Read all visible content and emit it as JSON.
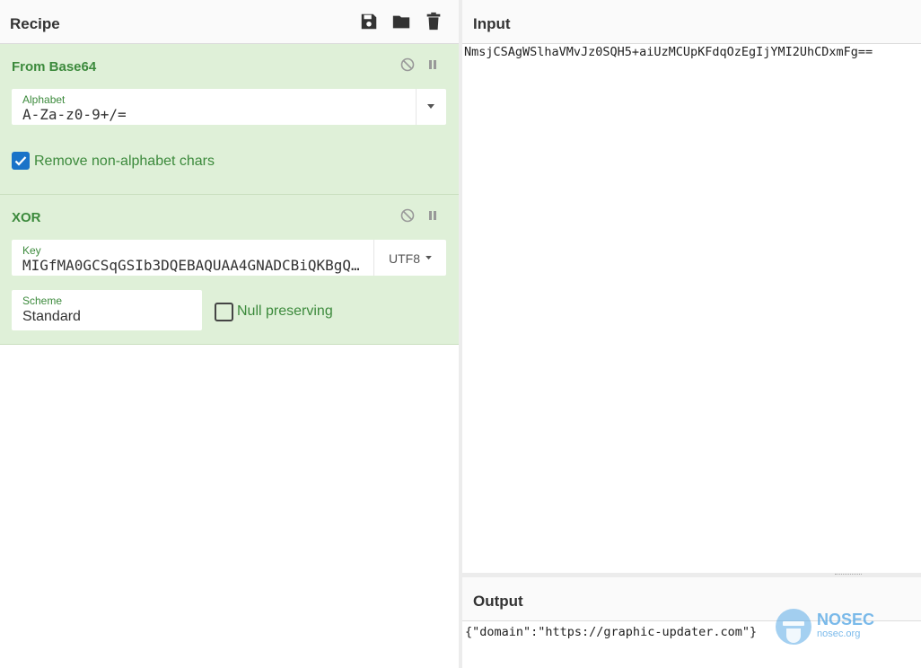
{
  "recipe": {
    "title": "Recipe",
    "toolbar": {
      "save_icon": "save-icon",
      "load_icon": "folder-icon",
      "clear_icon": "trash-icon"
    },
    "operations": [
      {
        "title": "From Base64",
        "alphabet_label": "Alphabet",
        "alphabet_value": "A-Za-z0-9+/=",
        "remove_label": "Remove non-alphabet chars",
        "remove_checked": true
      },
      {
        "title": "XOR",
        "key_label": "Key",
        "key_value": "MIGfMA0GCSqGSIb3DQEBAQUAA4GNADCBiQKBgQ…",
        "key_encoding": "UTF8",
        "scheme_label": "Scheme",
        "scheme_value": "Standard",
        "null_label": "Null preserving",
        "null_checked": false
      }
    ]
  },
  "input": {
    "title": "Input",
    "text": "NmsjCSAgWSlhaVMvJz0SQH5+aiUzMCUpKFdqOzEgIjYMI2UhCDxmFg=="
  },
  "output": {
    "title": "Output",
    "text": "{\"domain\":\"https://graphic-updater.com\"}"
  },
  "watermark": {
    "brand": "NOSEC",
    "site": "nosec.org"
  },
  "colors": {
    "op_background": "#dff0d8",
    "op_title": "#3c8a3c",
    "checkbox_checked": "#1a73c8"
  }
}
